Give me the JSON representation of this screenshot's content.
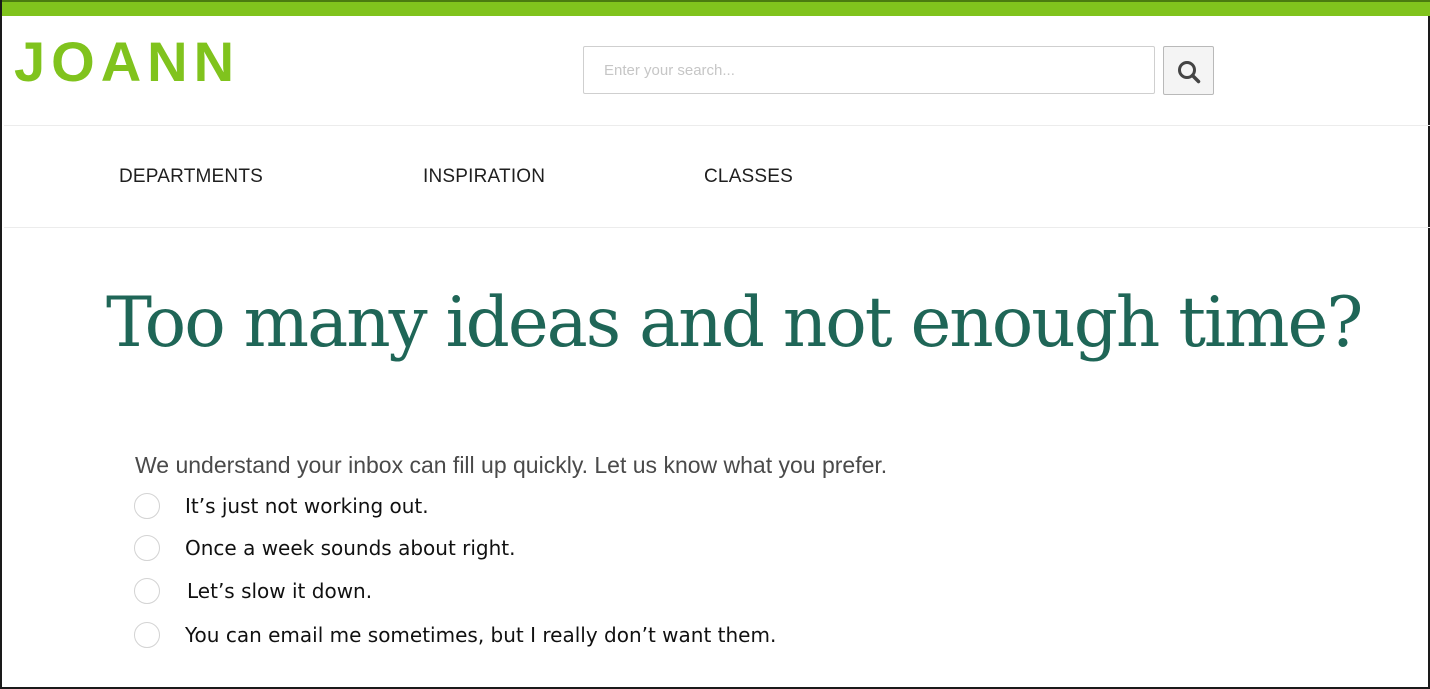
{
  "brand": {
    "logo_text": "JOANN",
    "accent_color": "#80c31d",
    "headline_color": "#1f6657"
  },
  "header": {
    "search": {
      "placeholder": "Enter your search...",
      "value": "",
      "button_icon": "search-icon"
    }
  },
  "nav": {
    "items": [
      {
        "label": "DEPARTMENTS"
      },
      {
        "label": "INSPIRATION"
      },
      {
        "label": "CLASSES"
      }
    ]
  },
  "main": {
    "headline": "Too many ideas and not enough time?",
    "prompt": "We understand your inbox can fill up quickly. Let us know what you prefer.",
    "options": [
      {
        "label": "It’s just not working out.",
        "selected": false
      },
      {
        "label": "Once a week sounds about right.",
        "selected": false
      },
      {
        "label": "Let’s slow it down.",
        "selected": false
      },
      {
        "label": "You can email me sometimes, but I really don’t want them.",
        "selected": false
      }
    ]
  }
}
